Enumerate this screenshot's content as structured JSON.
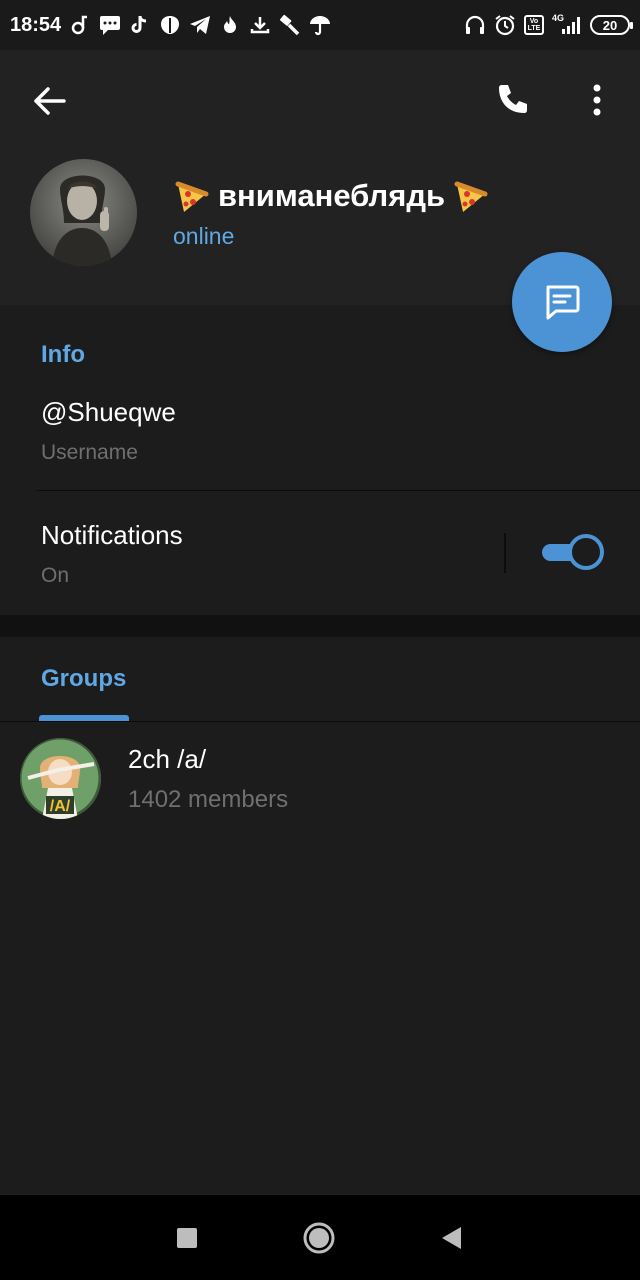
{
  "status_bar": {
    "time": "18:54",
    "battery": "20",
    "volte_label": "Vo LTE",
    "network_label": "4G"
  },
  "header": {
    "name": "вниманеблядь",
    "status": "online"
  },
  "info": {
    "title": "Info",
    "username_value": "@Shueqwe",
    "username_label": "Username",
    "notifications_label": "Notifications",
    "notifications_value": "On",
    "notifications_enabled": true
  },
  "groups": {
    "tab_label": "Groups",
    "items": [
      {
        "name": "2ch /a/",
        "members": "1402 members",
        "avatar_text": "/A/"
      }
    ]
  },
  "colors": {
    "accent": "#4b93d4",
    "accent_text": "#5fa8e4",
    "background": "#1c1c1d",
    "header": "#222223"
  }
}
